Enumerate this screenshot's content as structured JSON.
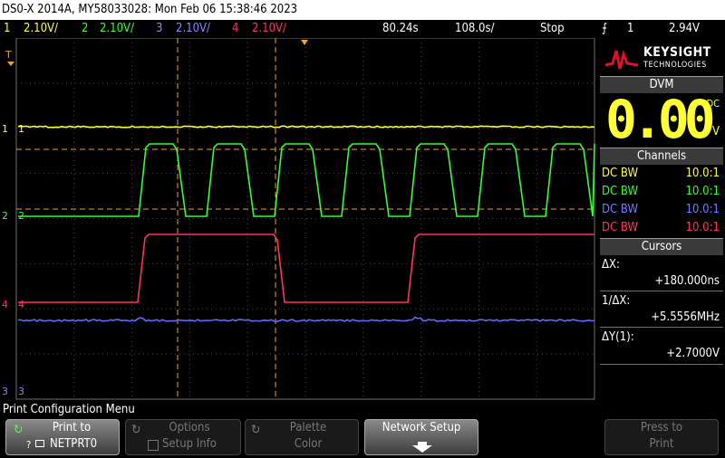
{
  "title_bar": "DS0-X 2014A, MY58033028: Mon Feb 06 15:38:46 2023",
  "settings": {
    "ch1": {
      "num": "1",
      "scale": "2.10V/",
      "color": "#ffff33"
    },
    "ch2": {
      "num": "2",
      "scale": "2.10V/",
      "color": "#33ff33"
    },
    "ch3": {
      "num": "3",
      "scale": "2.10V/",
      "color": "#6666ff"
    },
    "ch4": {
      "num": "4",
      "scale": "2.10V/",
      "color": "#ff3366"
    },
    "delay": "80.24s",
    "timebase": "108.0s/",
    "run_state": "Stop",
    "trigger_source": "1",
    "trigger_level": "2.94V"
  },
  "brand": {
    "name": "KEYSIGHT",
    "sub": "TECHNOLOGIES"
  },
  "dvm": {
    "header": "DVM",
    "value": "0.00",
    "coupling": "DC",
    "unit": "V"
  },
  "channels_panel": {
    "header": "Channels",
    "rows": [
      {
        "coupling": "DC BW",
        "probe": "10.0:1",
        "color": "#ffff33"
      },
      {
        "coupling": "DC BW",
        "probe": "10.0:1",
        "color": "#33ff33"
      },
      {
        "coupling": "DC BW",
        "probe": "10.0:1",
        "color": "#6666ff"
      },
      {
        "coupling": "DC BW",
        "probe": "10.0:1",
        "color": "#ff3366"
      }
    ]
  },
  "cursors": {
    "header": "Cursors",
    "dx_label": "ΔX:",
    "dx_value": "+180.000ns",
    "inv_label": "1/ΔX:",
    "inv_value": "+5.5556MHz",
    "dy_label": "ΔY(1):",
    "dy_value": "+2.7000V"
  },
  "markers": {
    "t": "T",
    "ch1": "1",
    "ch2": "2",
    "ch3": "3",
    "ch4": "4"
  },
  "menu_title": "Print Configuration Menu",
  "softkeys": {
    "print_to": {
      "l1": "Print to",
      "l2": "NETPRT0",
      "prefix": "?"
    },
    "options": {
      "l1": "Options",
      "l2": "Setup Info"
    },
    "palette": {
      "l1": "Palette",
      "l2": "Color"
    },
    "network": {
      "l1": "Network Setup"
    },
    "press_print": {
      "l1": "Press to",
      "l2": "Print"
    }
  }
}
